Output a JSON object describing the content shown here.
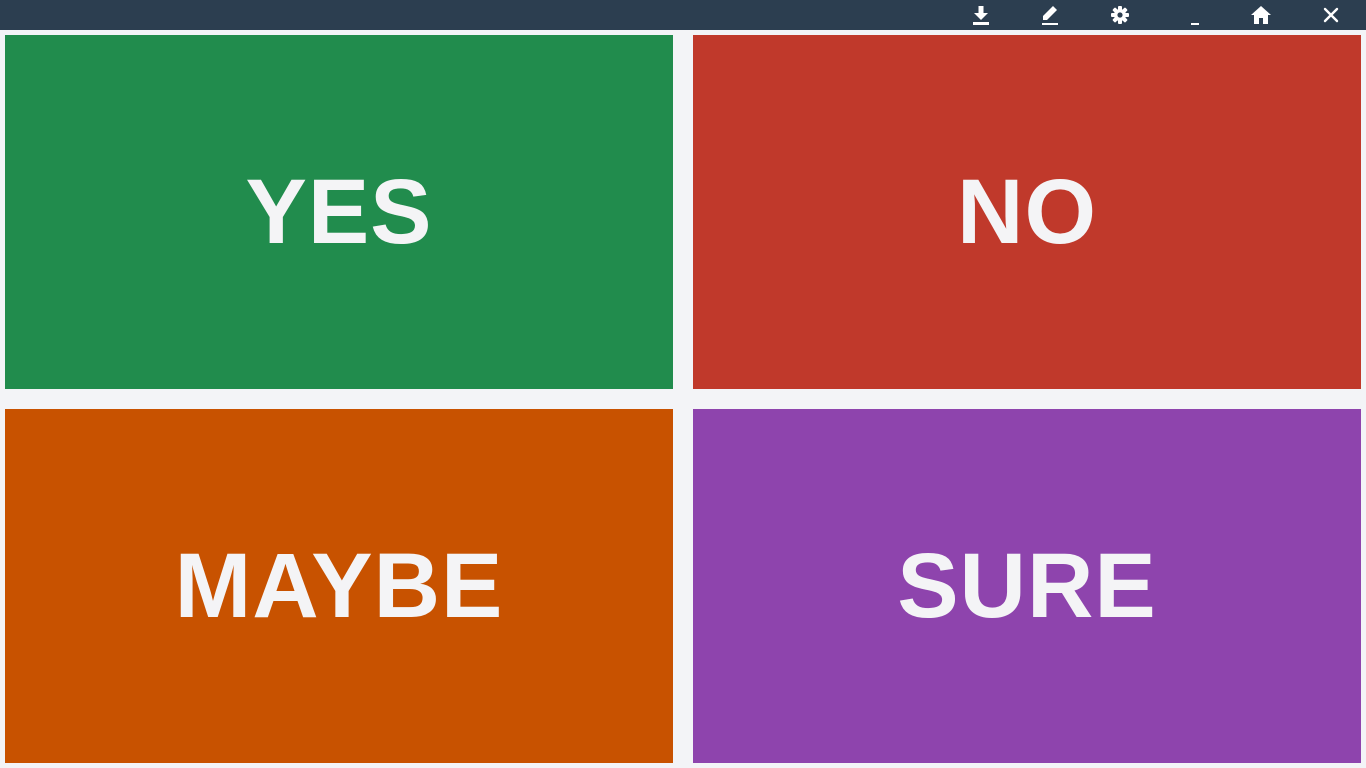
{
  "toolbar": {
    "buttons": [
      {
        "icon": "download-icon"
      },
      {
        "icon": "pencil-icon"
      },
      {
        "icon": "gear-icon"
      },
      {
        "icon": "minimize-icon"
      },
      {
        "icon": "home-icon"
      },
      {
        "icon": "close-icon"
      }
    ],
    "background": "#2c3e50",
    "icon_color": "#ffffff"
  },
  "tiles": [
    {
      "label": "YES",
      "color": "#218c4d"
    },
    {
      "label": "NO",
      "color": "#c0392b"
    },
    {
      "label": "MAYBE",
      "color": "#c85200"
    },
    {
      "label": "SURE",
      "color": "#8e44ad"
    }
  ],
  "background": "#f3f4f7"
}
